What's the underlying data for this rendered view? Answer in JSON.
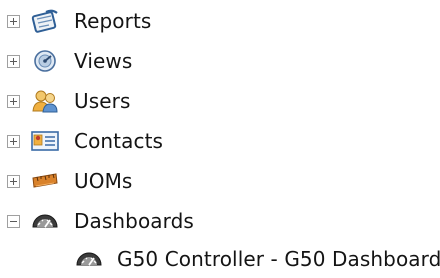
{
  "tree": {
    "nodes": [
      {
        "label": "Reports",
        "expanded": false,
        "icon": "reports-clipboard-icon"
      },
      {
        "label": "Views",
        "expanded": false,
        "icon": "views-gauge-icon"
      },
      {
        "label": "Users",
        "expanded": false,
        "icon": "users-people-icon"
      },
      {
        "label": "Contacts",
        "expanded": false,
        "icon": "contacts-card-icon"
      },
      {
        "label": "UOMs",
        "expanded": false,
        "icon": "uoms-ruler-icon"
      },
      {
        "label": "Dashboards",
        "expanded": true,
        "icon": "dashboard-icon",
        "children": [
          {
            "label": "G50 Controller - G50 Dashboard",
            "icon": "dashboard-icon"
          }
        ]
      }
    ]
  }
}
